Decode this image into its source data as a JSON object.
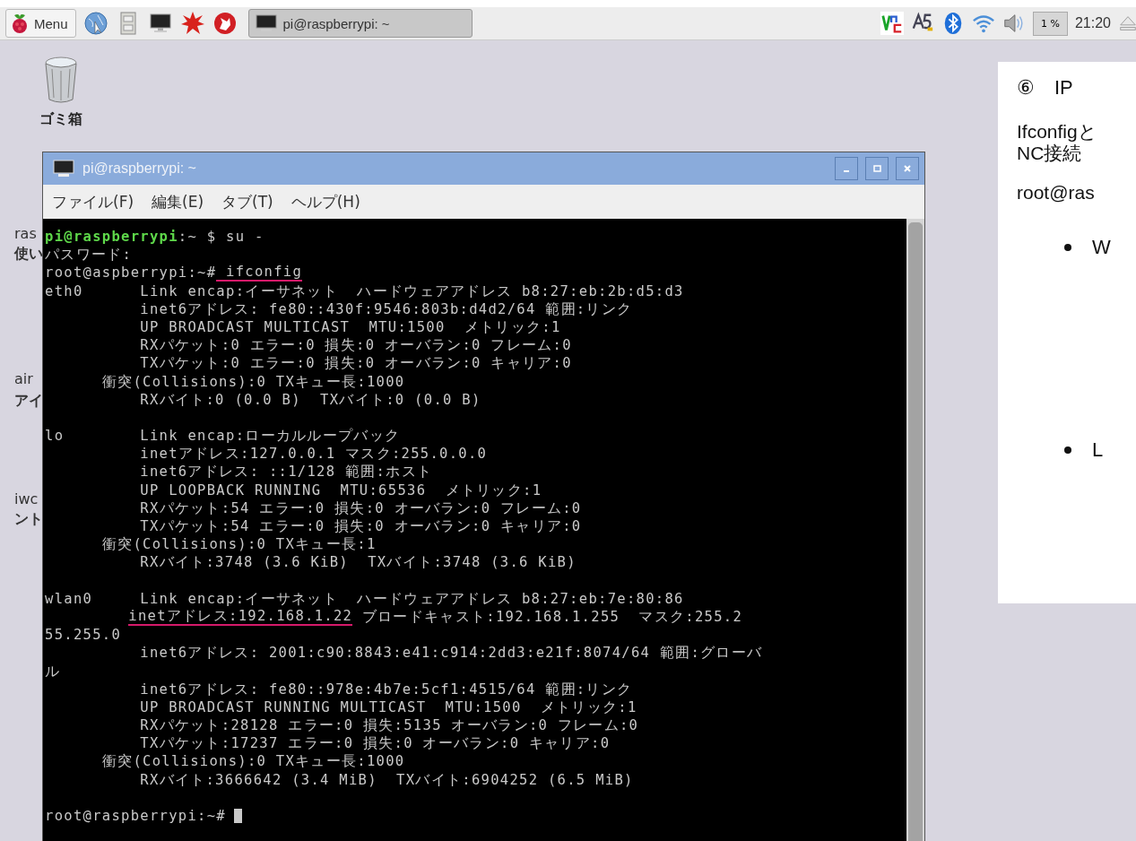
{
  "taskbar": {
    "menu_button": "Menu",
    "launchers": [
      {
        "kind": "globe"
      },
      {
        "kind": "cabinet"
      },
      {
        "kind": "monitor"
      },
      {
        "kind": "burst"
      },
      {
        "kind": "wolf"
      }
    ],
    "tasks": [
      {
        "label": "pi@raspberrypi: ~",
        "selected": true
      }
    ],
    "tray": [
      {
        "kind": "remote"
      },
      {
        "kind": "input"
      },
      {
        "kind": "bluetooth"
      },
      {
        "kind": "wifi"
      },
      {
        "kind": "volume"
      }
    ],
    "cpu_usage": "1 %",
    "clock": "21:20"
  },
  "desktop": {
    "trash_label": "ゴミ箱",
    "hidden_labels": [
      "ras",
      "使い",
      "air",
      "アイ",
      "iwc",
      "ント"
    ]
  },
  "terminal": {
    "title": "pi@raspberrypi: ~",
    "menu": [
      "ファイル(F)",
      "編集(E)",
      "タブ(T)",
      "ヘルプ(H)"
    ],
    "blocks": [
      [
        {
          "segments": [
            {
              "kind": "user",
              "text": "pi@raspberrypi"
            },
            {
              "kind": "text",
              "text": ":~ $ su -"
            }
          ]
        },
        {
          "segments": [
            {
              "kind": "text",
              "text": "パスワード:"
            }
          ]
        },
        {
          "segments": [
            {
              "kind": "text",
              "text": "root@aspberrypi:~#"
            },
            {
              "kind": "marked",
              "text": " ifconfig"
            }
          ]
        },
        {
          "segments": [
            {
              "kind": "text",
              "text": "eth0      Link encap:イーサネット  ハードウェアアドレス b8:27:eb:2b:d5:d3"
            }
          ]
        },
        {
          "segments": [
            {
              "kind": "text",
              "text": "          inet6アドレス: fe80::430f:9546:803b:d4d2/64 範囲:リンク"
            }
          ]
        },
        {
          "segments": [
            {
              "kind": "text",
              "text": "          UP BROADCAST MULTICAST  MTU:1500  メトリック:1"
            }
          ]
        },
        {
          "segments": [
            {
              "kind": "text",
              "text": "          RXパケット:0 エラー:0 損失:0 オーバラン:0 フレーム:0"
            }
          ]
        },
        {
          "segments": [
            {
              "kind": "text",
              "text": "          TXパケット:0 エラー:0 損失:0 オーバラン:0 キャリア:0"
            }
          ]
        },
        {
          "segments": [
            {
              "kind": "text",
              "text": "      衝突(Collisions):0 TXキュー長:1000"
            }
          ]
        },
        {
          "segments": [
            {
              "kind": "text",
              "text": "          RXバイト:0 (0.0 B)  TXバイト:0 (0.0 B)"
            }
          ]
        }
      ],
      [
        {
          "segments": [
            {
              "kind": "text",
              "text": "lo        Link encap:ローカルループバック"
            }
          ]
        },
        {
          "segments": [
            {
              "kind": "text",
              "text": "          inetアドレス:127.0.0.1 マスク:255.0.0.0"
            }
          ]
        },
        {
          "segments": [
            {
              "kind": "text",
              "text": "          inet6アドレス: ::1/128 範囲:ホスト"
            }
          ]
        },
        {
          "segments": [
            {
              "kind": "text",
              "text": "          UP LOOPBACK RUNNING  MTU:65536  メトリック:1"
            }
          ]
        },
        {
          "segments": [
            {
              "kind": "text",
              "text": "          RXパケット:54 エラー:0 損失:0 オーバラン:0 フレーム:0"
            }
          ]
        },
        {
          "segments": [
            {
              "kind": "text",
              "text": "          TXパケット:54 エラー:0 損失:0 オーバラン:0 キャリア:0"
            }
          ]
        },
        {
          "segments": [
            {
              "kind": "text",
              "text": "      衝突(Collisions):0 TXキュー長:1"
            }
          ]
        },
        {
          "segments": [
            {
              "kind": "text",
              "text": "          RXバイト:3748 (3.6 KiB)  TXバイト:3748 (3.6 KiB)"
            }
          ]
        }
      ],
      [
        {
          "segments": [
            {
              "kind": "text",
              "text": "wlan0     Link encap:イーサネット  ハードウェアアドレス b8:27:eb:7e:80:86"
            }
          ]
        },
        {
          "indented": true,
          "segments": [
            {
              "kind": "marked",
              "text": "inetアドレス:192.168.1.22"
            },
            {
              "kind": "text",
              "text": " ブロードキャスト:192.168.1.255  マスク:255.2"
            }
          ]
        },
        {
          "segments": [
            {
              "kind": "text",
              "text": "55.255.0"
            }
          ]
        },
        {
          "segments": [
            {
              "kind": "text",
              "text": "          inet6アドレス: 2001:c90:8843:e41:c914:2dd3:e21f:8074/64 範囲:グローバ"
            }
          ]
        },
        {
          "segments": [
            {
              "kind": "text",
              "text": "ル"
            }
          ]
        },
        {
          "segments": [
            {
              "kind": "text",
              "text": "          inet6アドレス: fe80::978e:4b7e:5cf1:4515/64 範囲:リンク"
            }
          ]
        },
        {
          "segments": [
            {
              "kind": "text",
              "text": "          UP BROADCAST RUNNING MULTICAST  MTU:1500  メトリック:1"
            }
          ]
        },
        {
          "segments": [
            {
              "kind": "text",
              "text": "          RXパケット:28128 エラー:0 損失:5135 オーバラン:0 フレーム:0"
            }
          ]
        },
        {
          "segments": [
            {
              "kind": "text",
              "text": "          TXパケット:17237 エラー:0 損失:0 オーバラン:0 キャリア:0"
            }
          ]
        },
        {
          "segments": [
            {
              "kind": "text",
              "text": "      衝突(Collisions):0 TXキュー長:1000"
            }
          ]
        },
        {
          "segments": [
            {
              "kind": "text",
              "text": "          RXバイト:3666642 (3.4 MiB)  TXバイト:6904252 (6.5 MiB)"
            }
          ]
        }
      ],
      [
        {
          "segments": [
            {
              "kind": "text",
              "text": "root@raspberrypi:~#"
            }
          ]
        }
      ]
    ]
  },
  "slide": {
    "heading": "⑥　IP",
    "paragraph_lines": [
      "Ifconfigと",
      "NC接続"
    ],
    "command": "root@ras",
    "bullets": [
      "W",
      "L"
    ]
  }
}
